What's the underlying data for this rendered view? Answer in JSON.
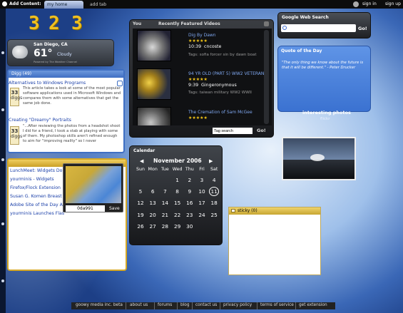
{
  "topbar": {
    "add_content": "Add Content:",
    "tabs": [
      "my home",
      "add tab"
    ],
    "user_links": [
      "sign in",
      "sign up"
    ]
  },
  "clock": {
    "digits": [
      "3",
      "2",
      "3"
    ]
  },
  "weather": {
    "city": "San Diego, CA",
    "temp": "61°",
    "condition": "Cloudy",
    "credit": "Powered by The Weather Channel"
  },
  "digg": {
    "title": "Digg (49)",
    "stories": [
      {
        "title": "Alternatives to Windows Programs",
        "diggs": "33",
        "label": "diggs",
        "text": "This article takes a look at some of the most popular software applications used in Microsoft Windows and compares them with some alternatives that get the same job done."
      },
      {
        "title": "Creating \"Dreamy\" Portraits",
        "diggs": "33",
        "label": "diggs",
        "text": "\"...After reviewing the photos from a headshot shoot I did for a friend, I took a stab at playing with some of them. My photoshop skills aren't refined enough to aim for \"improving reality\" so I never"
      }
    ]
  },
  "rss": {
    "items": [
      "LunchMeet: Widgets Don",
      "yourminis - Widgets",
      "Firefox/Flock Extension",
      "Susan G. Komen Breast",
      "Adobe Site of the Day A",
      "yourminis Launches Flas"
    ]
  },
  "popup": {
    "color_value": "0da991",
    "save": "Save"
  },
  "videos": {
    "header_left": "You",
    "title": "Recently Featured Videos",
    "items": [
      {
        "title": "Dig By Dawn",
        "stars": "★★★★★",
        "time": "10:39",
        "author": "cncoste",
        "tags": "Tags: sofia forcer sin by dawn boat"
      },
      {
        "title": "94 YR OLD (PART 5) WW2 VETERAN",
        "stars": "★★★★★",
        "time": "9:39",
        "author": "Gingeronymous",
        "tags": "Tags: taiwan military WW2 WWII"
      },
      {
        "title": "The Cremation of Sam McGee",
        "stars": "★★★★★",
        "time": "",
        "author": "",
        "tags": ""
      }
    ],
    "search_value": "Tag search",
    "go": "Go!"
  },
  "calendar": {
    "title": "Calendar",
    "prev": "◀",
    "month": "November 2006",
    "next": "▶",
    "weekdays": [
      "Sun",
      "Mon",
      "Tue",
      "Wed",
      "Thu",
      "Fri",
      "Sat"
    ],
    "days": [
      "",
      "",
      "",
      "1",
      "2",
      "3",
      "4",
      "5",
      "6",
      "7",
      "8",
      "9",
      "10",
      "11",
      "12",
      "13",
      "14",
      "15",
      "16",
      "17",
      "18",
      "19",
      "20",
      "21",
      "22",
      "23",
      "24",
      "25",
      "26",
      "27",
      "28",
      "29",
      "30",
      ""
    ],
    "today": "11"
  },
  "google": {
    "title": "Google Web Search",
    "go": "Go!"
  },
  "quote": {
    "title": "Quote of the Day",
    "text": "\"The only thing we know about the future is that it will be different.\" - Peter Drucker"
  },
  "photos": {
    "title": "interesting photos",
    "sub": "flickr"
  },
  "stickies": {
    "title": "sticky (0)"
  },
  "footer": {
    "links": [
      "goowy media inc. beta",
      "about us",
      "forums",
      "blog",
      "contact us",
      "privacy policy",
      "terms of service",
      "get extension"
    ]
  }
}
